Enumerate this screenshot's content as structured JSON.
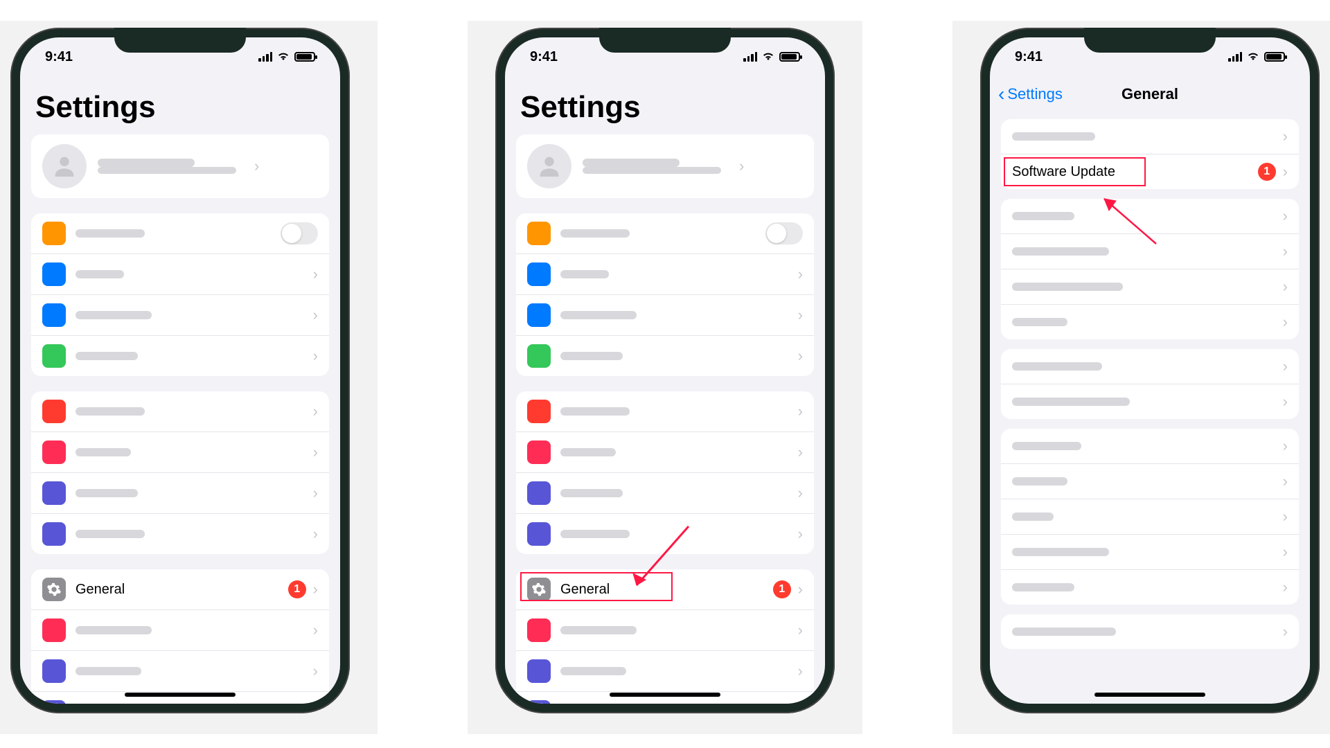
{
  "status": {
    "time": "9:41"
  },
  "settings": {
    "title": "Settings",
    "general_label": "General",
    "general_badge": "1"
  },
  "general": {
    "back_label": "Settings",
    "title": "General",
    "software_update_label": "Software Update",
    "software_update_badge": "1"
  },
  "colors": {
    "accent": "#007aff",
    "badge": "#ff3b30",
    "highlight": "#ff1744"
  }
}
